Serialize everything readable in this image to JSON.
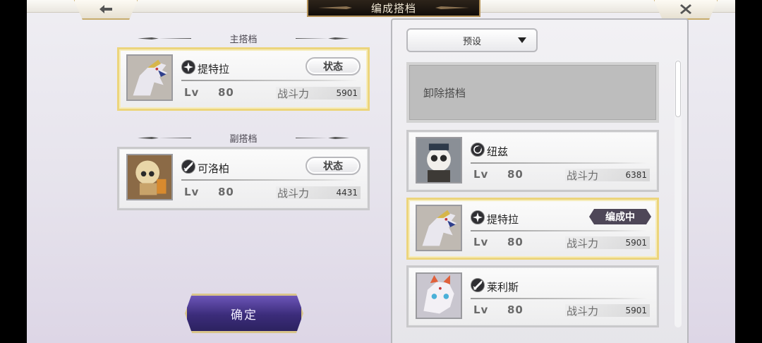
{
  "header": {
    "title": "编成搭档"
  },
  "main_section": {
    "label": "主搭档"
  },
  "sub_section": {
    "label": "副搭档"
  },
  "main_partner": {
    "name": "提特拉",
    "lv_tag": "Lv",
    "lv": "80",
    "power_label": "战斗力",
    "power": "5901",
    "status": "状态"
  },
  "sub_partner": {
    "name": "可洛柏",
    "lv_tag": "Lv",
    "lv": "80",
    "power_label": "战斗力",
    "power": "4431",
    "status": "状态"
  },
  "confirm": {
    "label": "确定"
  },
  "preset": {
    "label": "预设"
  },
  "unequip": {
    "label": "卸除搭档"
  },
  "list": [
    {
      "name": "纽兹",
      "lv_tag": "Lv",
      "lv": "80",
      "power_label": "战斗力",
      "power": "6381"
    },
    {
      "name": "提特拉",
      "lv_tag": "Lv",
      "lv": "80",
      "power_label": "战斗力",
      "power": "5901",
      "badge": "编成中"
    },
    {
      "name": "莱利斯",
      "lv_tag": "Lv",
      "lv": "80",
      "power_label": "战斗力",
      "power": "5901"
    }
  ],
  "colors": {
    "selected_border": "#ecd57c",
    "badge_bg": "#4e4758",
    "confirm_bg": "#3b2c7a"
  },
  "icons": {
    "back": "arrow-left-icon",
    "close": "close-icon"
  }
}
